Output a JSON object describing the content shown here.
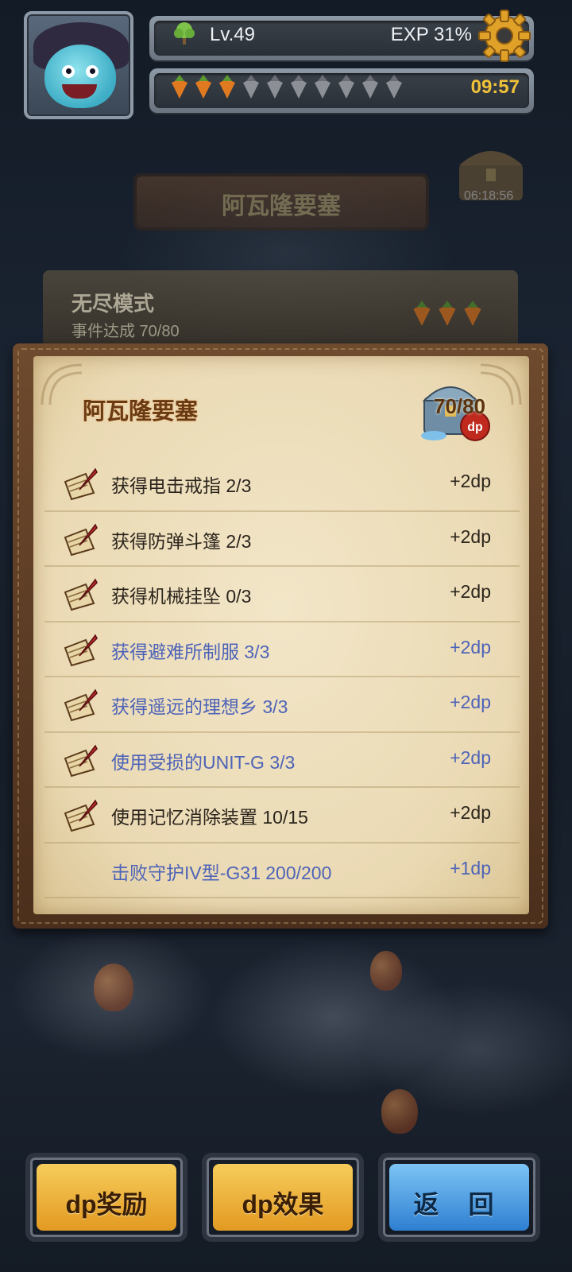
{
  "header": {
    "level": "Lv.49",
    "exp": "EXP 31%",
    "timer": "09:57",
    "carrots": {
      "filled": 3,
      "total": 10
    },
    "level_icon": "tree-icon",
    "settings_icon": "gear-icon"
  },
  "chest": {
    "timer": "06:18:56"
  },
  "location_sign": "阿瓦隆要塞",
  "endless": {
    "title": "无尽模式",
    "progress": "事件达成 70/80"
  },
  "panel": {
    "title": "阿瓦隆要塞",
    "count": "70/80",
    "badge": "dp",
    "items": [
      {
        "text": "获得电击戒指 2/3",
        "points": "+2dp",
        "done": false,
        "icon": true
      },
      {
        "text": "获得防弹斗篷 2/3",
        "points": "+2dp",
        "done": false,
        "icon": true
      },
      {
        "text": "获得机械挂坠 0/3",
        "points": "+2dp",
        "done": false,
        "icon": true
      },
      {
        "text": "获得避难所制服 3/3",
        "points": "+2dp",
        "done": true,
        "icon": true
      },
      {
        "text": "获得遥远的理想乡 3/3",
        "points": "+2dp",
        "done": true,
        "icon": true
      },
      {
        "text": "使用受损的UNIT-G 3/3",
        "points": "+2dp",
        "done": true,
        "icon": true
      },
      {
        "text": "使用记忆消除装置 10/15",
        "points": "+2dp",
        "done": false,
        "icon": true
      },
      {
        "text": "击败守护IV型-G31 200/200",
        "points": "+1dp",
        "done": true,
        "icon": false
      }
    ]
  },
  "buttons": {
    "reward": "dp奖励",
    "effect": "dp效果",
    "back": "返 回"
  },
  "colors": {
    "completed_text": "#4e63b8",
    "normal_text": "#2b241c",
    "gold_button": "#f0b43a",
    "blue_button": "#4f9fe6",
    "timer": "#f0c23a"
  }
}
